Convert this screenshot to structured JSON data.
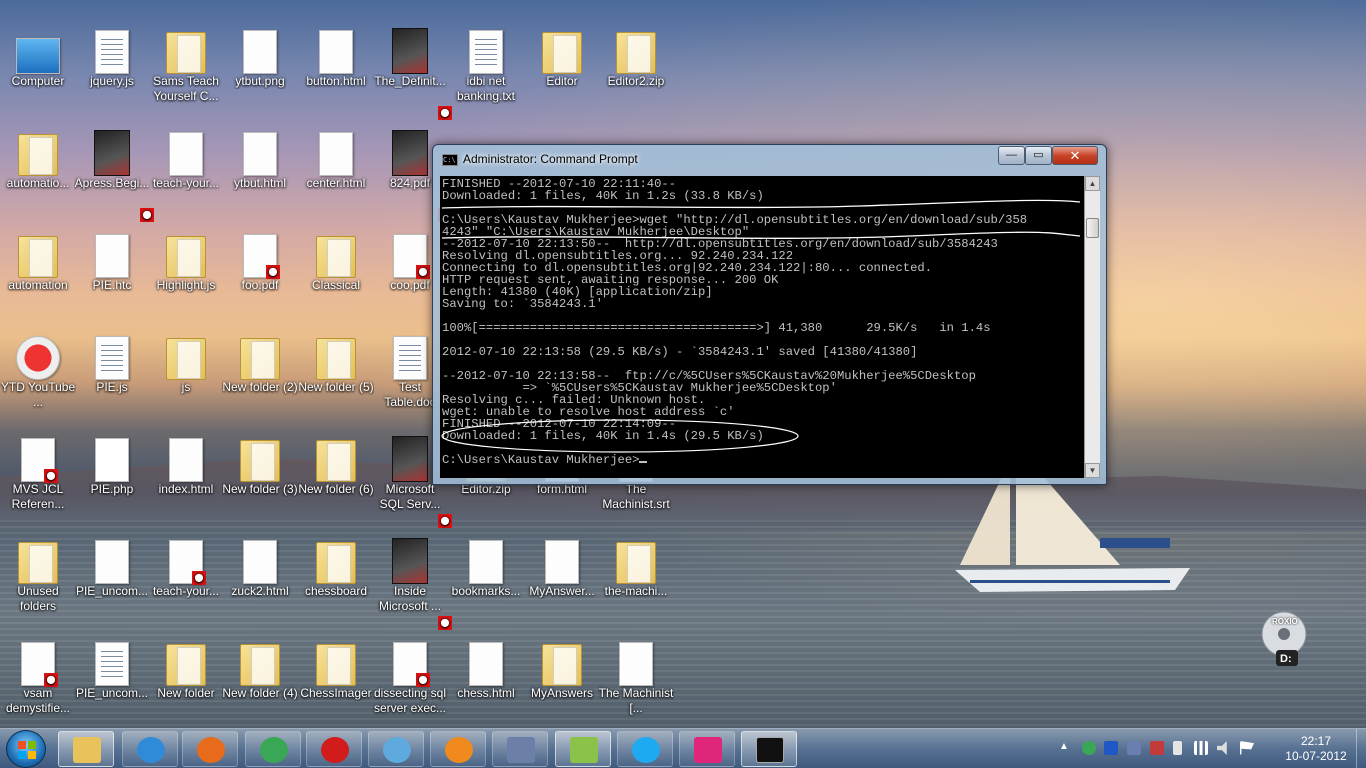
{
  "desktop": {
    "icons": [
      {
        "label": "Computer",
        "icon": "computer-icon"
      },
      {
        "label": "jquery.js",
        "icon": "script-file-icon"
      },
      {
        "label": "Sams Teach Yourself C...",
        "icon": "folder-icon"
      },
      {
        "label": "ytbut.png",
        "icon": "image-file-icon"
      },
      {
        "label": "button.html",
        "icon": "html-file-icon"
      },
      {
        "label": "The_Definit...",
        "icon": "pdf-book-icon"
      },
      {
        "label": "idbi net banking.txt",
        "icon": "text-file-icon"
      },
      {
        "label": "Editor",
        "icon": "folder-icon"
      },
      {
        "label": "Editor2.zip",
        "icon": "zip-folder-icon"
      },
      {
        "label": "automatio...",
        "icon": "zip-folder-icon"
      },
      {
        "label": "Apress.Begi...",
        "icon": "pdf-book-icon"
      },
      {
        "label": "teach-your...",
        "icon": "help-file-icon"
      },
      {
        "label": "ytbut.html",
        "icon": "html-file-icon"
      },
      {
        "label": "center.html",
        "icon": "html-file-icon"
      },
      {
        "label": "824.pdf",
        "icon": "pdf-book-icon"
      },
      {
        "label": "automation",
        "icon": "zip-folder-icon"
      },
      {
        "label": "PIE.htc",
        "icon": "generic-file-icon"
      },
      {
        "label": "Highlight.js",
        "icon": "folder-icon"
      },
      {
        "label": "foo.pdf",
        "icon": "pdf-file-icon"
      },
      {
        "label": "Classical",
        "icon": "folder-icon"
      },
      {
        "label": "coo.pdf",
        "icon": "pdf-file-icon"
      },
      {
        "label": "YTD YouTube ...",
        "icon": "ytd-shortcut-icon"
      },
      {
        "label": "PIE.js",
        "icon": "script-file-icon"
      },
      {
        "label": "js",
        "icon": "folder-icon"
      },
      {
        "label": "New folder (2)",
        "icon": "folder-icon"
      },
      {
        "label": "New folder (5)",
        "icon": "folder-icon"
      },
      {
        "label": "Test Table.doc",
        "icon": "word-doc-icon"
      },
      {
        "label": "MVS JCL Referen...",
        "icon": "pdf-file-icon"
      },
      {
        "label": "PIE.php",
        "icon": "php-file-icon"
      },
      {
        "label": "index.html",
        "icon": "html-file-icon"
      },
      {
        "label": "New folder (3)",
        "icon": "folder-icon"
      },
      {
        "label": "New folder (6)",
        "icon": "folder-icon"
      },
      {
        "label": "Microsoft SQL Serv...",
        "icon": "pdf-book-icon"
      },
      {
        "label": "Editor.zip",
        "icon": "zip-folder-icon"
      },
      {
        "label": "form.html",
        "icon": "html-file-icon"
      },
      {
        "label": "The Machinist.srt",
        "icon": "text-file-icon"
      },
      {
        "label": "Unused folders",
        "icon": "zip-folder-icon"
      },
      {
        "label": "PIE_uncom...",
        "icon": "generic-file-icon"
      },
      {
        "label": "teach-your...",
        "icon": "pdf-file-icon"
      },
      {
        "label": "zuck2.html",
        "icon": "html-file-icon"
      },
      {
        "label": "chessboard",
        "icon": "folder-icon"
      },
      {
        "label": "Inside Microsoft ...",
        "icon": "pdf-book-icon"
      },
      {
        "label": "bookmarks...",
        "icon": "html-file-icon"
      },
      {
        "label": "MyAnswer...",
        "icon": "winrar-archive-icon"
      },
      {
        "label": "the-machi...",
        "icon": "zip-folder-icon"
      },
      {
        "label": "vsam demystifie...",
        "icon": "pdf-file-icon"
      },
      {
        "label": "PIE_uncom...",
        "icon": "script-file-icon"
      },
      {
        "label": "New folder",
        "icon": "folder-icon"
      },
      {
        "label": "New folder (4)",
        "icon": "folder-icon"
      },
      {
        "label": "ChessImager",
        "icon": "folder-icon"
      },
      {
        "label": "dissecting sql server exec...",
        "icon": "pdf-file-icon"
      },
      {
        "label": "chess.html",
        "icon": "html-file-icon"
      },
      {
        "label": "MyAnswers",
        "icon": "folder-icon"
      },
      {
        "label": "The Machinist [...",
        "icon": "srt-file-icon"
      }
    ],
    "roxio_label": "ROXIO",
    "roxio_drive": "D:"
  },
  "cmd": {
    "title": "Administrator: Command Prompt",
    "title_icon_text": "C:\\",
    "lines": [
      "FINISHED --2012-07-10 22:11:40--",
      "Downloaded: 1 files, 40K in 1.2s (33.8 KB/s)",
      "",
      "C:\\Users\\Kaustav Mukherjee>wget \"http://dl.opensubtitles.org/en/download/sub/358",
      "4243\" \"C:\\Users\\Kaustav Mukherjee\\Desktop\"",
      "--2012-07-10 22:13:50--  http://dl.opensubtitles.org/en/download/sub/3584243",
      "Resolving dl.opensubtitles.org... 92.240.234.122",
      "Connecting to dl.opensubtitles.org|92.240.234.122|:80... connected.",
      "HTTP request sent, awaiting response... 200 OK",
      "Length: 41380 (40K) [application/zip]",
      "Saving to: `3584243.1'",
      "",
      "100%[======================================>] 41,380      29.5K/s   in 1.4s",
      "",
      "2012-07-10 22:13:58 (29.5 KB/s) - `3584243.1' saved [41380/41380]",
      "",
      "--2012-07-10 22:13:58--  ftp://c/%5CUsers%5CKaustav%20Mukherjee%5CDesktop",
      "           => `%5CUsers%5CKaustav Mukherjee%5CDesktop'",
      "Resolving c... failed: Unknown host.",
      "wget: unable to resolve host address `c'",
      "FINISHED --2012-07-10 22:14:09--",
      "Downloaded: 1 files, 40K in 1.4s (29.5 KB/s)",
      "",
      "C:\\Users\\Kaustav Mukherjee>"
    ],
    "buttons": {
      "minimize": "—",
      "maximize": "▭",
      "close": "✕"
    }
  },
  "taskbar": {
    "apps": [
      {
        "name": "Windows Explorer",
        "icon": "explorer-icon",
        "color": "#e8c25a"
      },
      {
        "name": "Internet Explorer",
        "icon": "ie-icon",
        "color": "#2f8ad8"
      },
      {
        "name": "Firefox",
        "icon": "firefox-icon",
        "color": "#e86b1c"
      },
      {
        "name": "Google Chrome",
        "icon": "chrome-icon",
        "color": "#3aa757"
      },
      {
        "name": "Opera",
        "icon": "opera-icon",
        "color": "#d21b1b"
      },
      {
        "name": "Safari",
        "icon": "safari-icon",
        "color": "#5ea9dd"
      },
      {
        "name": "VLC",
        "icon": "vlc-icon",
        "color": "#f08a1c"
      },
      {
        "name": "VirtualBox",
        "icon": "virtualbox-icon",
        "color": "#6b7fa8"
      },
      {
        "name": "Notepad++",
        "icon": "notepadpp-icon",
        "color": "#8bc34a"
      },
      {
        "name": "Skype",
        "icon": "skype-icon",
        "color": "#1eaaf1"
      },
      {
        "name": "WampServer",
        "icon": "wamp-icon",
        "color": "#e0267a"
      },
      {
        "name": "Command Prompt",
        "icon": "cmd-icon",
        "color": "#111111"
      }
    ],
    "time": "22:17",
    "date": "10-07-2012"
  }
}
